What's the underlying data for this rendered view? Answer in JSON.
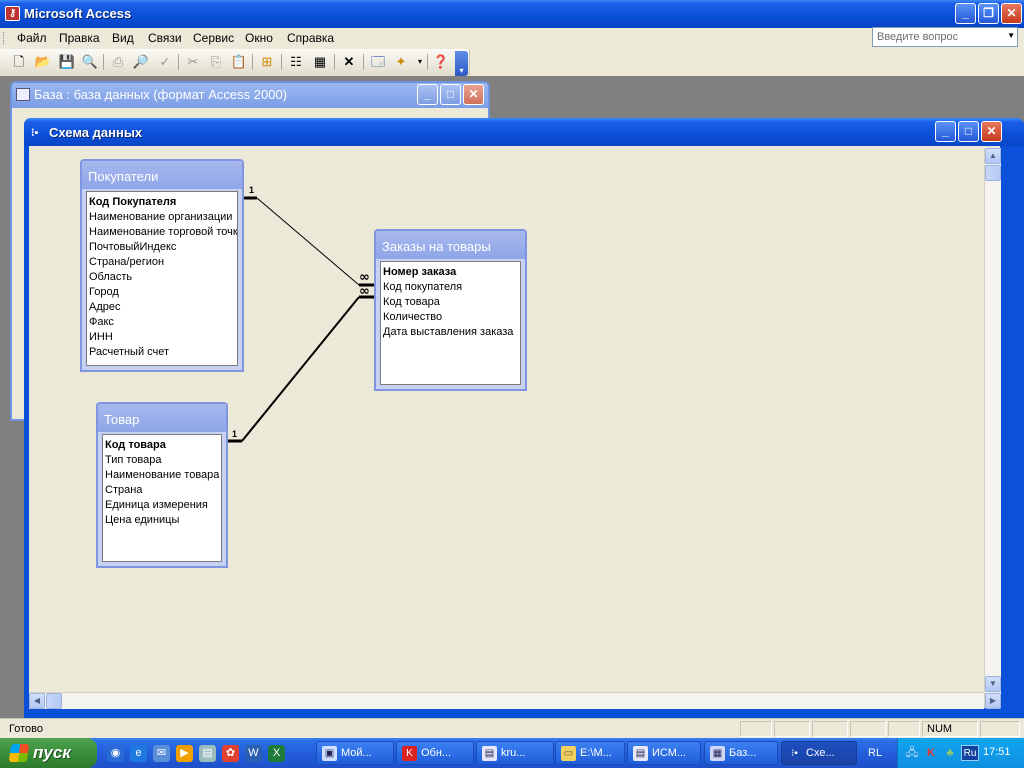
{
  "app": {
    "title": "Microsoft Access"
  },
  "menu": {
    "items": [
      "Файл",
      "Правка",
      "Вид",
      "Связи",
      "Сервис",
      "Окно",
      "Справка"
    ],
    "ask_placeholder": "Введите вопрос"
  },
  "db_window": {
    "title": "База : база данных (формат Access 2000)"
  },
  "rel_window": {
    "title": "Схема данных"
  },
  "tables": {
    "customers": {
      "title": "Покупатели",
      "fields": [
        "Код Покупателя",
        "Наименование организации",
        "Наименование торговой точк",
        "ПочтовыйИндекс",
        "Страна/регион",
        "Область",
        "Город",
        "Адрес",
        "Факс",
        "ИНН",
        "Расчетный счет"
      ]
    },
    "orders": {
      "title": "Заказы на товары",
      "fields": [
        "Номер заказа",
        "Код покупателя",
        "Код товара",
        "Количество",
        "Дата выставления  заказа"
      ]
    },
    "goods": {
      "title": "Товар",
      "fields": [
        "Код товара",
        "Тип товара",
        "Наименование товара",
        "Страна",
        "Единица измерения",
        "Цена единицы"
      ]
    }
  },
  "relations": {
    "one_label": "1",
    "many_label": "∞"
  },
  "status": {
    "text": "Готово",
    "num": "NUM"
  },
  "taskbar": {
    "start_label": "пуск",
    "buttons": [
      "Мой...",
      "Обн...",
      "kru...",
      "E:\\M...",
      "ИСМ...",
      "Баз...",
      "Схе..."
    ],
    "lang": "RL",
    "tray_lang": "Ru",
    "clock": "17:51"
  }
}
